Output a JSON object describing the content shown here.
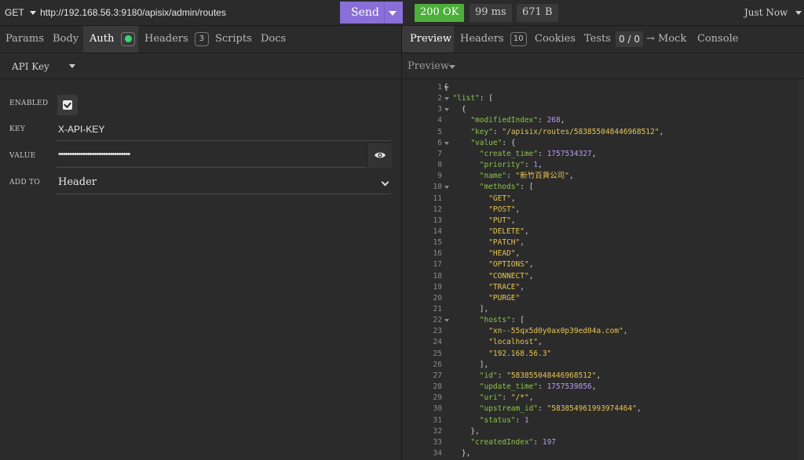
{
  "request": {
    "method": "GET",
    "url": "http://192.168.56.3:9180/apisix/admin/routes",
    "send_label": "Send"
  },
  "response": {
    "status": "200 OK",
    "time": "99 ms",
    "size": "671 B",
    "history_label": "Just Now"
  },
  "request_tabs": [
    {
      "label": "Params"
    },
    {
      "label": "Body"
    },
    {
      "label": "Auth",
      "active": true
    },
    {
      "label": "Headers",
      "badge": "3"
    },
    {
      "label": "Scripts"
    },
    {
      "label": "Docs"
    }
  ],
  "response_tabs": [
    {
      "label": "Preview",
      "active": true
    },
    {
      "label": "Headers",
      "badge": "10"
    },
    {
      "label": "Cookies"
    },
    {
      "label": "Tests",
      "badge": "0 / 0"
    },
    {
      "label": "→ Mock"
    },
    {
      "label": "Console"
    }
  ],
  "auth": {
    "type": "API Key",
    "enabled_label": "ENABLED",
    "enabled": true,
    "key_label": "KEY",
    "key_value": "X-API-KEY",
    "value_label": "VALUE",
    "value_masked": "••••••••••••••••••••••••••••••••",
    "add_to_label": "ADD TO",
    "add_to_value": "Header"
  },
  "preview": {
    "mode": "Preview",
    "lines": [
      {
        "n": "1",
        "fold": true,
        "t": [
          [
            "p",
            "{"
          ]
        ]
      },
      {
        "n": "2",
        "fold": true,
        "t": [
          [
            "p",
            "  "
          ],
          [
            "k",
            "\"list\""
          ],
          [
            "p",
            ": ["
          ]
        ]
      },
      {
        "n": "3",
        "fold": true,
        "t": [
          [
            "p",
            "    {"
          ]
        ]
      },
      {
        "n": "4",
        "t": [
          [
            "p",
            "      "
          ],
          [
            "k",
            "\"modifiedIndex\""
          ],
          [
            "p",
            ": "
          ],
          [
            "n",
            "268"
          ],
          [
            "p",
            ","
          ]
        ]
      },
      {
        "n": "5",
        "t": [
          [
            "p",
            "      "
          ],
          [
            "k",
            "\"key\""
          ],
          [
            "p",
            ": "
          ],
          [
            "s",
            "\"/apisix/routes/583855048446968512\""
          ],
          [
            "p",
            ","
          ]
        ]
      },
      {
        "n": "6",
        "fold": true,
        "t": [
          [
            "p",
            "      "
          ],
          [
            "k",
            "\"value\""
          ],
          [
            "p",
            ": {"
          ]
        ]
      },
      {
        "n": "7",
        "t": [
          [
            "p",
            "        "
          ],
          [
            "k",
            "\"create_time\""
          ],
          [
            "p",
            ": "
          ],
          [
            "n",
            "1757534327"
          ],
          [
            "p",
            ","
          ]
        ]
      },
      {
        "n": "8",
        "t": [
          [
            "p",
            "        "
          ],
          [
            "k",
            "\"priority\""
          ],
          [
            "p",
            ": "
          ],
          [
            "n",
            "1"
          ],
          [
            "p",
            ","
          ]
        ]
      },
      {
        "n": "9",
        "t": [
          [
            "p",
            "        "
          ],
          [
            "k",
            "\"name\""
          ],
          [
            "p",
            ": "
          ],
          [
            "s",
            "\"新竹百貨公司\""
          ],
          [
            "p",
            ","
          ]
        ]
      },
      {
        "n": "10",
        "fold": true,
        "t": [
          [
            "p",
            "        "
          ],
          [
            "k",
            "\"methods\""
          ],
          [
            "p",
            ": ["
          ]
        ]
      },
      {
        "n": "11",
        "t": [
          [
            "p",
            "          "
          ],
          [
            "s",
            "\"GET\""
          ],
          [
            "p",
            ","
          ]
        ]
      },
      {
        "n": "12",
        "t": [
          [
            "p",
            "          "
          ],
          [
            "s",
            "\"POST\""
          ],
          [
            "p",
            ","
          ]
        ]
      },
      {
        "n": "13",
        "t": [
          [
            "p",
            "          "
          ],
          [
            "s",
            "\"PUT\""
          ],
          [
            "p",
            ","
          ]
        ]
      },
      {
        "n": "14",
        "t": [
          [
            "p",
            "          "
          ],
          [
            "s",
            "\"DELETE\""
          ],
          [
            "p",
            ","
          ]
        ]
      },
      {
        "n": "15",
        "t": [
          [
            "p",
            "          "
          ],
          [
            "s",
            "\"PATCH\""
          ],
          [
            "p",
            ","
          ]
        ]
      },
      {
        "n": "16",
        "t": [
          [
            "p",
            "          "
          ],
          [
            "s",
            "\"HEAD\""
          ],
          [
            "p",
            ","
          ]
        ]
      },
      {
        "n": "17",
        "t": [
          [
            "p",
            "          "
          ],
          [
            "s",
            "\"OPTIONS\""
          ],
          [
            "p",
            ","
          ]
        ]
      },
      {
        "n": "18",
        "t": [
          [
            "p",
            "          "
          ],
          [
            "s",
            "\"CONNECT\""
          ],
          [
            "p",
            ","
          ]
        ]
      },
      {
        "n": "19",
        "t": [
          [
            "p",
            "          "
          ],
          [
            "s",
            "\"TRACE\""
          ],
          [
            "p",
            ","
          ]
        ]
      },
      {
        "n": "20",
        "t": [
          [
            "p",
            "          "
          ],
          [
            "s",
            "\"PURGE\""
          ]
        ]
      },
      {
        "n": "21",
        "t": [
          [
            "p",
            "        ],"
          ]
        ]
      },
      {
        "n": "22",
        "fold": true,
        "t": [
          [
            "p",
            "        "
          ],
          [
            "k",
            "\"hosts\""
          ],
          [
            "p",
            ": ["
          ]
        ]
      },
      {
        "n": "23",
        "t": [
          [
            "p",
            "          "
          ],
          [
            "s",
            "\"xn--55qx5d0y0ax0p39ed04a.com\""
          ],
          [
            "p",
            ","
          ]
        ]
      },
      {
        "n": "24",
        "t": [
          [
            "p",
            "          "
          ],
          [
            "s",
            "\"localhost\""
          ],
          [
            "p",
            ","
          ]
        ]
      },
      {
        "n": "25",
        "t": [
          [
            "p",
            "          "
          ],
          [
            "s",
            "\"192.168.56.3\""
          ]
        ]
      },
      {
        "n": "26",
        "t": [
          [
            "p",
            "        ],"
          ]
        ]
      },
      {
        "n": "27",
        "t": [
          [
            "p",
            "        "
          ],
          [
            "k",
            "\"id\""
          ],
          [
            "p",
            ": "
          ],
          [
            "s",
            "\"583855048446968512\""
          ],
          [
            "p",
            ","
          ]
        ]
      },
      {
        "n": "28",
        "t": [
          [
            "p",
            "        "
          ],
          [
            "k",
            "\"update_time\""
          ],
          [
            "p",
            ": "
          ],
          [
            "n",
            "1757539856"
          ],
          [
            "p",
            ","
          ]
        ]
      },
      {
        "n": "29",
        "t": [
          [
            "p",
            "        "
          ],
          [
            "k",
            "\"uri\""
          ],
          [
            "p",
            ": "
          ],
          [
            "s",
            "\"/*\""
          ],
          [
            "p",
            ","
          ]
        ]
      },
      {
        "n": "30",
        "t": [
          [
            "p",
            "        "
          ],
          [
            "k",
            "\"upstream_id\""
          ],
          [
            "p",
            ": "
          ],
          [
            "s",
            "\"583854961993974464\""
          ],
          [
            "p",
            ","
          ]
        ]
      },
      {
        "n": "31",
        "t": [
          [
            "p",
            "        "
          ],
          [
            "k",
            "\"status\""
          ],
          [
            "p",
            ": "
          ],
          [
            "n",
            "1"
          ]
        ]
      },
      {
        "n": "32",
        "t": [
          [
            "p",
            "      },"
          ]
        ]
      },
      {
        "n": "33",
        "t": [
          [
            "p",
            "      "
          ],
          [
            "k",
            "\"createdIndex\""
          ],
          [
            "p",
            ": "
          ],
          [
            "n",
            "197"
          ]
        ]
      },
      {
        "n": "34",
        "t": [
          [
            "p",
            "    },"
          ]
        ]
      }
    ]
  },
  "colors": {
    "send": "#8a6fd8",
    "status_ok": "#4caf39",
    "json_key": "#8bc34a",
    "json_string": "#e6c454",
    "json_number": "#b49cf0"
  }
}
